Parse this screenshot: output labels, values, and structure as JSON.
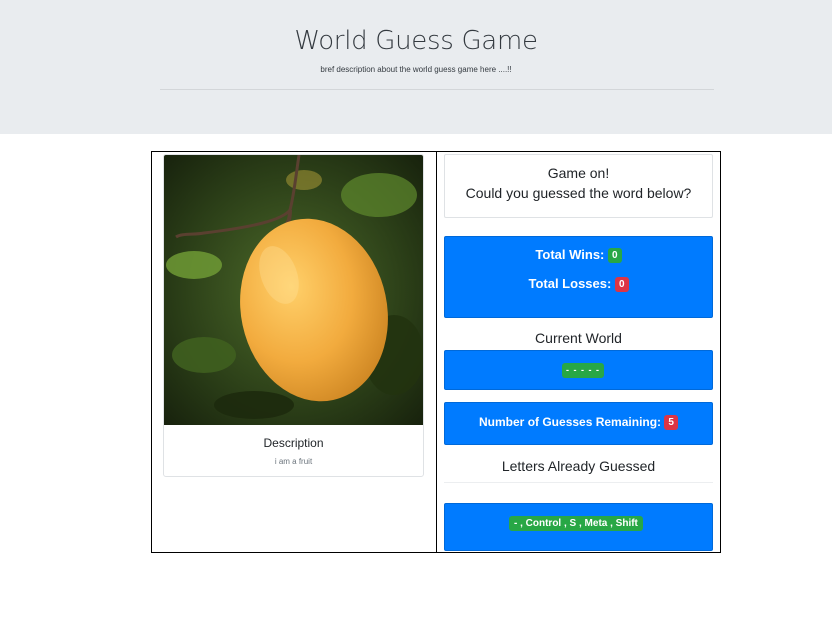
{
  "header": {
    "title": "World Guess Game",
    "description": "bref description about the world guess game here ....!!"
  },
  "card": {
    "image_alt": "mango",
    "title": "Description",
    "text": "i am a fruit"
  },
  "message": {
    "line1": "Game on!",
    "line2": "Could you guessed the word below?"
  },
  "stats": {
    "wins_label": "Total Wins:",
    "wins": "0",
    "losses_label": "Total Losses:",
    "losses": "0"
  },
  "current_word": {
    "heading": "Current World",
    "value": "- - - - -"
  },
  "guesses": {
    "label": "Number of Guesses Remaining:",
    "remaining": "5"
  },
  "letters": {
    "heading": "Letters Already Guessed",
    "value": "- , Control , S , Meta , Shift"
  },
  "colors": {
    "primary": "#007bff",
    "success": "#28a745",
    "danger": "#dc3545",
    "jumbotron": "#e9ecef"
  }
}
